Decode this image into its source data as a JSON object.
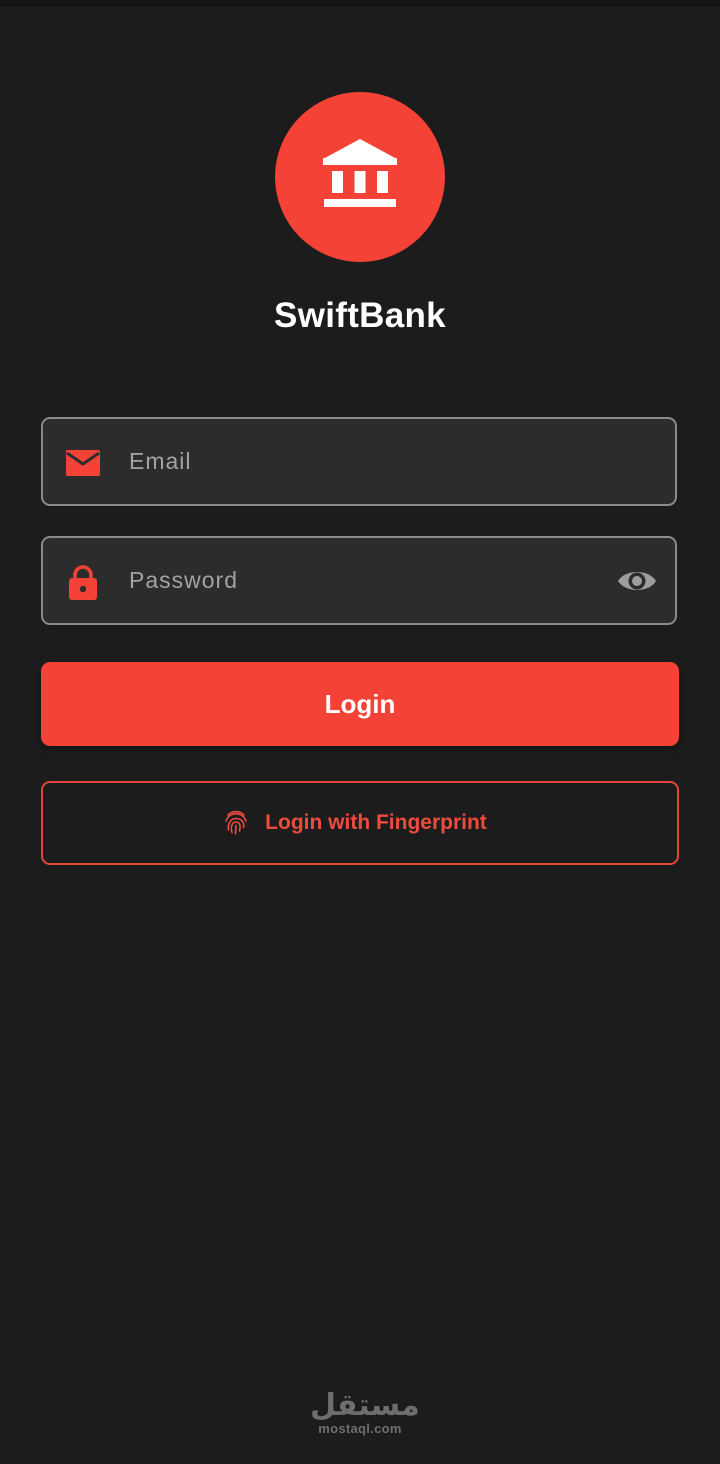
{
  "app": {
    "title": "SwiftBank",
    "brand_color": "#f44336",
    "background_color": "#1c1c1c"
  },
  "logo": {
    "icon": "bank-icon"
  },
  "form": {
    "email": {
      "placeholder": "Email",
      "value": "",
      "icon": "envelope-icon"
    },
    "password": {
      "placeholder": "Password",
      "value": "",
      "icon": "lock-icon",
      "toggle_icon": "eye-icon"
    }
  },
  "actions": {
    "login_label": "Login",
    "fingerprint_label": "Login with Fingerprint",
    "fingerprint_icon": "fingerprint-icon"
  },
  "watermark": {
    "arabic": "مستقل",
    "latin": "mostaql.com"
  }
}
